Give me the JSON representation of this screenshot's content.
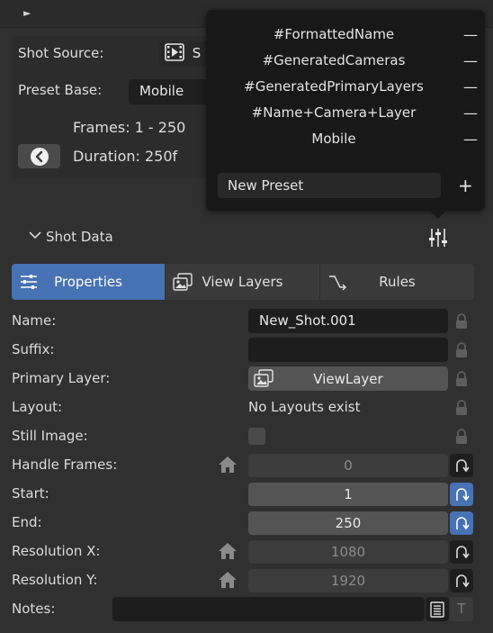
{
  "top_panel": {
    "arrow": "►"
  },
  "shot_source": {
    "label": "Shot Source:",
    "value_prefix": "S"
  },
  "preset_base": {
    "label": "Preset Base:",
    "value": "Mobile"
  },
  "frames": {
    "text": "Frames: 1 - 250"
  },
  "duration": {
    "text": "Duration: 250f"
  },
  "presets_popup": {
    "items": [
      {
        "name": "#FormattedName",
        "remove": "—"
      },
      {
        "name": "#GeneratedCameras",
        "remove": "—"
      },
      {
        "name": "#GeneratedPrimaryLayers",
        "remove": "—"
      },
      {
        "name": "#Name+Camera+Layer",
        "remove": "—"
      },
      {
        "name": "Mobile",
        "remove": "—"
      }
    ],
    "new_preset_value": "New Preset",
    "add": "+"
  },
  "shot_data": {
    "title": "Shot Data"
  },
  "tabs": [
    {
      "label": "Properties",
      "active": true
    },
    {
      "label": "View Layers",
      "active": false
    },
    {
      "label": "Rules",
      "active": false
    }
  ],
  "props": {
    "name": {
      "label": "Name:",
      "value": "New_Shot.001"
    },
    "suffix": {
      "label": "Suffix:",
      "value": ""
    },
    "primary_layer": {
      "label": "Primary Layer:",
      "value": "ViewLayer"
    },
    "layout": {
      "label": "Layout:",
      "value": "No Layouts exist"
    },
    "still_image": {
      "label": "Still Image:"
    },
    "handle_frames": {
      "label": "Handle Frames:",
      "value": "0"
    },
    "start": {
      "label": "Start:",
      "value": "1"
    },
    "end": {
      "label": "End:",
      "value": "250"
    },
    "resolution_x": {
      "label": "Resolution X:",
      "value": "1080"
    },
    "resolution_y": {
      "label": "Resolution Y:",
      "value": "1920"
    },
    "notes": {
      "label": "Notes:",
      "t_icon": "T"
    }
  },
  "colors": {
    "accent": "#4772b3",
    "background": "#303030",
    "popup": "#181818"
  }
}
